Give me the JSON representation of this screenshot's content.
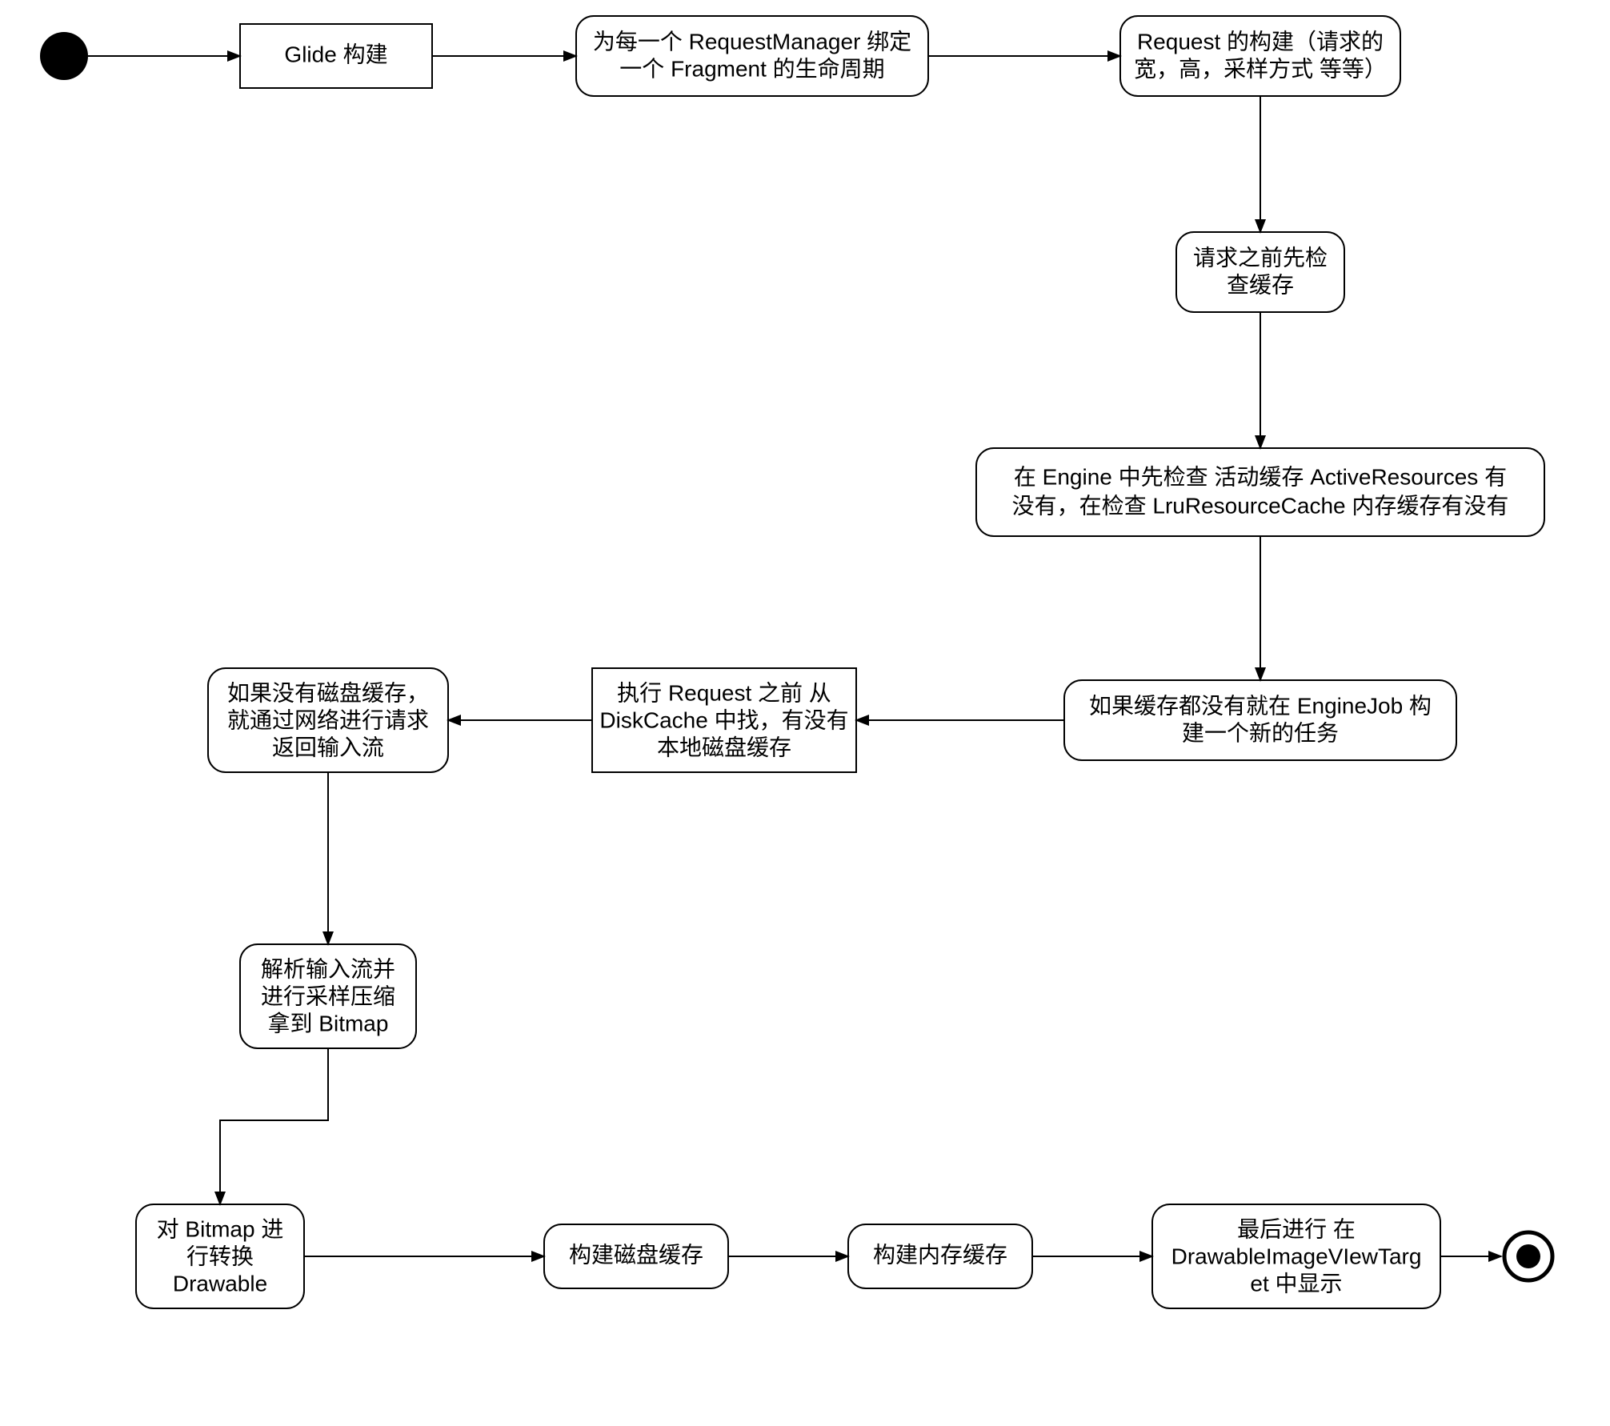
{
  "diagram": {
    "type": "activity-diagram",
    "subject": "Glide 图片加载流程",
    "nodes": {
      "n1": {
        "lines": [
          "Glide 构建"
        ]
      },
      "n2": {
        "lines": [
          "为每一个 RequestManager 绑定",
          "一个 Fragment  的生命周期"
        ]
      },
      "n3": {
        "lines": [
          "Request 的构建（请求的",
          "宽，高，采样方式 等等）"
        ]
      },
      "n4": {
        "lines": [
          "请求之前先检",
          "查缓存"
        ]
      },
      "n5": {
        "lines": [
          "在 Engine 中先检查 活动缓存 ActiveResources 有",
          "没有，在检查 LruResourceCache 内存缓存有没有"
        ]
      },
      "n6": {
        "lines": [
          "如果缓存都没有就在 EngineJob 构",
          "建一个新的任务"
        ]
      },
      "n7": {
        "lines": [
          "执行 Request 之前 从",
          "DiskCache 中找，有没有",
          "本地磁盘缓存"
        ]
      },
      "n8": {
        "lines": [
          "如果没有磁盘缓存，",
          "就通过网络进行请求",
          "返回输入流"
        ]
      },
      "n9": {
        "lines": [
          "解析输入流并",
          "进行采样压缩",
          "拿到 Bitmap"
        ]
      },
      "n10": {
        "lines": [
          "对 Bitmap 进",
          "行转换",
          "Drawable"
        ]
      },
      "n11": {
        "lines": [
          "构建磁盘缓存"
        ]
      },
      "n12": {
        "lines": [
          "构建内存缓存"
        ]
      },
      "n13": {
        "lines": [
          "最后进行 在",
          "DrawableImageVIewTarg",
          "et 中显示"
        ]
      }
    },
    "edges": [
      [
        "start",
        "n1"
      ],
      [
        "n1",
        "n2"
      ],
      [
        "n2",
        "n3"
      ],
      [
        "n3",
        "n4"
      ],
      [
        "n4",
        "n5"
      ],
      [
        "n5",
        "n6"
      ],
      [
        "n6",
        "n7"
      ],
      [
        "n7",
        "n8"
      ],
      [
        "n8",
        "n9"
      ],
      [
        "n9",
        "n10"
      ],
      [
        "n10",
        "n11"
      ],
      [
        "n11",
        "n12"
      ],
      [
        "n12",
        "n13"
      ],
      [
        "n13",
        "end"
      ]
    ]
  }
}
